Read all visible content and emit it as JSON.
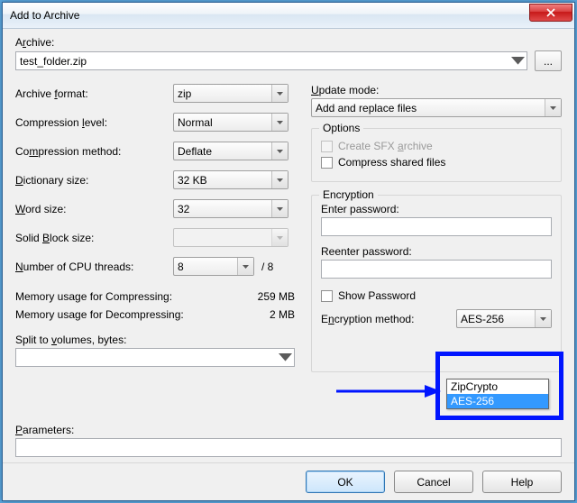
{
  "window": {
    "title": "Add to Archive"
  },
  "archive": {
    "label_pre": "A",
    "label_u": "r",
    "label_post": "chive:",
    "value": "test_folder.zip",
    "browse": "..."
  },
  "left": {
    "format": {
      "pre": "Archive ",
      "u": "f",
      "post": "ormat:",
      "value": "zip"
    },
    "level": {
      "pre": "Compression ",
      "u": "l",
      "post": "evel:",
      "value": "Normal"
    },
    "method": {
      "pre": "Co",
      "u": "m",
      "post": "pression method:",
      "value": "Deflate"
    },
    "dict": {
      "u": "D",
      "post": "ictionary size:",
      "value": "32 KB"
    },
    "word": {
      "u": "W",
      "post": "ord size:",
      "value": "32"
    },
    "solid": {
      "pre": "Solid ",
      "u": "B",
      "post": "lock size:",
      "value": ""
    },
    "threads": {
      "u": "N",
      "post": "umber of CPU threads:",
      "value": "8",
      "max": "/ 8"
    },
    "memC": {
      "label": "Memory usage for Compressing:",
      "value": "259 MB"
    },
    "memD": {
      "label": "Memory usage for Decompressing:",
      "value": "2 MB"
    },
    "split": {
      "pre": "Split to ",
      "u": "v",
      "post": "olumes, bytes:",
      "value": ""
    },
    "params": {
      "u": "P",
      "post": "arameters:",
      "value": ""
    }
  },
  "right": {
    "update": {
      "u": "U",
      "post": "pdate mode:",
      "value": "Add and replace files"
    },
    "options_title": "Options",
    "opt_sfx": {
      "pre": "Create SFX ",
      "u": "a",
      "post": "rchive"
    },
    "opt_shared": {
      "pre": "Compress shared files"
    },
    "enc_title": "Encryption",
    "pwd1": "Enter password:",
    "pwd2": "Reenter password:",
    "showpwd": "Show Password",
    "encmethod": {
      "pre": "E",
      "u": "n",
      "post": "cryption method:",
      "value": "AES-256"
    },
    "enc_options": {
      "a": "ZipCrypto",
      "b": "AES-256"
    }
  },
  "buttons": {
    "ok": "OK",
    "cancel": "Cancel",
    "help": "Help"
  }
}
